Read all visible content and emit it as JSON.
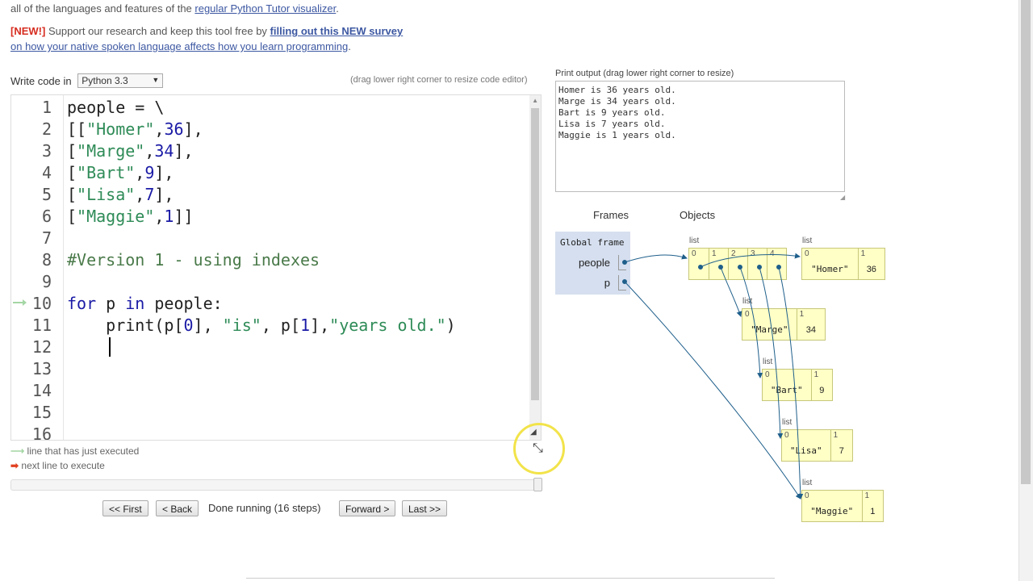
{
  "intro": {
    "line1_prefix": "all of the languages and features of the ",
    "line1_link": "regular Python Tutor visualizer",
    "line1_suffix": ".",
    "new_tag": "[NEW!]",
    "line2_text": " Support our research and keep this tool free by ",
    "line2_link": "filling out this NEW survey",
    "line3_link": "on how your native spoken language affects how you learn programming",
    "line3_suffix": "."
  },
  "editor": {
    "write_code_label": "Write code in",
    "language": "Python 3.3",
    "drag_hint": "(drag lower right corner to resize code editor)",
    "lines": [
      {
        "n": "1"
      },
      {
        "n": "2"
      },
      {
        "n": "3"
      },
      {
        "n": "4"
      },
      {
        "n": "5"
      },
      {
        "n": "6"
      },
      {
        "n": "7"
      },
      {
        "n": "8"
      },
      {
        "n": "9"
      },
      {
        "n": "10"
      },
      {
        "n": "11"
      },
      {
        "n": "12"
      },
      {
        "n": "13"
      },
      {
        "n": "14"
      },
      {
        "n": "15"
      },
      {
        "n": "16"
      }
    ],
    "code": {
      "l1": "people = \\",
      "l2a": "[[",
      "l2s": "\"Homer\"",
      "l2b": ",",
      "l2n": "36",
      "l2c": "],",
      "l3a": "[",
      "l3s": "\"Marge\"",
      "l3b": ",",
      "l3n": "34",
      "l3c": "],",
      "l4a": "[",
      "l4s": "\"Bart\"",
      "l4b": ",",
      "l4n": "9",
      "l4c": "],",
      "l5a": "[",
      "l5s": "\"Lisa\"",
      "l5b": ",",
      "l5n": "7",
      "l5c": "],",
      "l6a": "[",
      "l6s": "\"Maggie\"",
      "l6b": ",",
      "l6n": "1",
      "l6c": "]]",
      "l8": "#Version 1 - using indexes",
      "l10kw1": "for",
      "l10a": " p ",
      "l10kw2": "in",
      "l10b": " people:",
      "l11a": "    print(p[",
      "l11n0": "0",
      "l11b": "], ",
      "l11s1": "\"is\"",
      "l11c": ", p[",
      "l11n1": "1",
      "l11d": "],",
      "l11s2": "\"years old.\"",
      "l11e": ")"
    }
  },
  "legend": {
    "just_executed": "line that has just executed",
    "next_line": "next line to execute"
  },
  "nav": {
    "first": "<< First",
    "back": "< Back",
    "status": "Done running (16 steps)",
    "forward": "Forward >",
    "last": "Last >>"
  },
  "output": {
    "label": "Print output (drag lower right corner to resize)",
    "text": "Homer is 36 years old.\nMarge is 34 years old.\nBart is 9 years old.\nLisa is 7 years old.\nMaggie is 1 years old."
  },
  "viz": {
    "frames_header": "Frames",
    "objects_header": "Objects",
    "global_frame": "Global frame",
    "vars": [
      "people",
      "p"
    ],
    "list_label": "list",
    "outer_indices": [
      "0",
      "1",
      "2",
      "3",
      "4"
    ],
    "inner": [
      {
        "i0": "0",
        "i1": "1",
        "v0": "\"Homer\"",
        "v1": "36"
      },
      {
        "i0": "0",
        "i1": "1",
        "v0": "\"Marge\"",
        "v1": "34"
      },
      {
        "i0": "0",
        "i1": "1",
        "v0": "\"Bart\"",
        "v1": "9"
      },
      {
        "i0": "0",
        "i1": "1",
        "v0": "\"Lisa\"",
        "v1": "7"
      },
      {
        "i0": "0",
        "i1": "1",
        "v0": "\"Maggie\"",
        "v1": "1"
      }
    ]
  },
  "colors": {
    "link": "#3D58A2",
    "new_tag": "#d62d20",
    "frame_bg": "#d5dfef",
    "list_bg": "#ffffc6",
    "arrow": "#1f5f8b"
  }
}
